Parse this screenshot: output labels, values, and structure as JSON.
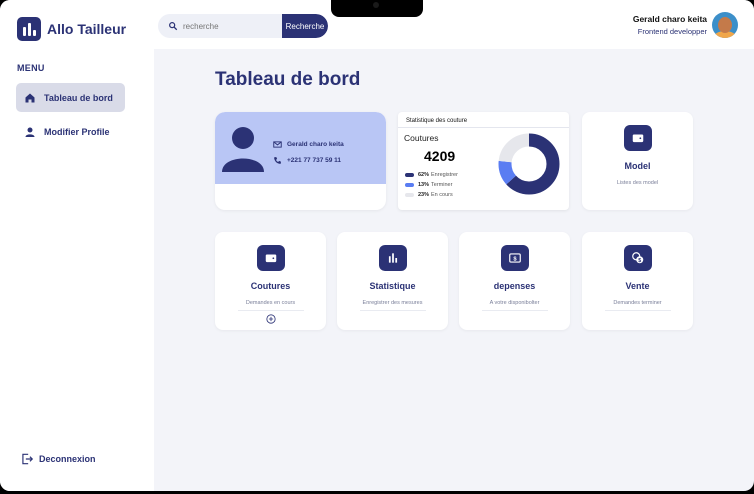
{
  "app": {
    "name": "Allo Tailleur"
  },
  "sidebar": {
    "menu_title": "MENU",
    "items": [
      {
        "label": "Tableau de bord",
        "icon": "home-icon",
        "active": true
      },
      {
        "label": "Modifier Profile",
        "icon": "person-icon",
        "active": false
      }
    ],
    "logout_label": "Deconnexion"
  },
  "header": {
    "search_placeholder": "recherche",
    "search_button": "Recherche",
    "user_name": "Gerald charo keita",
    "user_role": "Frontend developper"
  },
  "main": {
    "title": "Tableau de bord",
    "profile": {
      "name": "Gerald charo keita",
      "phone": "+221 77 737 59 11"
    },
    "stats": {
      "header": "Statistique des couture",
      "category": "Coutures",
      "total": "4209"
    },
    "model_card": {
      "title": "Model",
      "subtitle": "Listes des model"
    },
    "cards": [
      {
        "title": "Coutures",
        "subtitle": "Demandes en cours",
        "icon": "wallet-icon"
      },
      {
        "title": "Statistique",
        "subtitle": "Enregistrer des mesures",
        "icon": "bar-chart-icon"
      },
      {
        "title": "depenses",
        "subtitle": "A votre disponibolter",
        "icon": "money-icon"
      },
      {
        "title": "Vente",
        "subtitle": "Demandes  terminer",
        "icon": "coins-icon"
      }
    ]
  },
  "chart_data": {
    "type": "pie",
    "title": "Statistique des couture",
    "categories": [
      "Enregistrer",
      "Terminer",
      "En cours"
    ],
    "values": [
      62,
      13,
      23
    ],
    "labels": [
      "62%",
      "13%",
      "23%"
    ],
    "colors": [
      "#2b3275",
      "#5a7df2",
      "#e6e7ec"
    ]
  }
}
